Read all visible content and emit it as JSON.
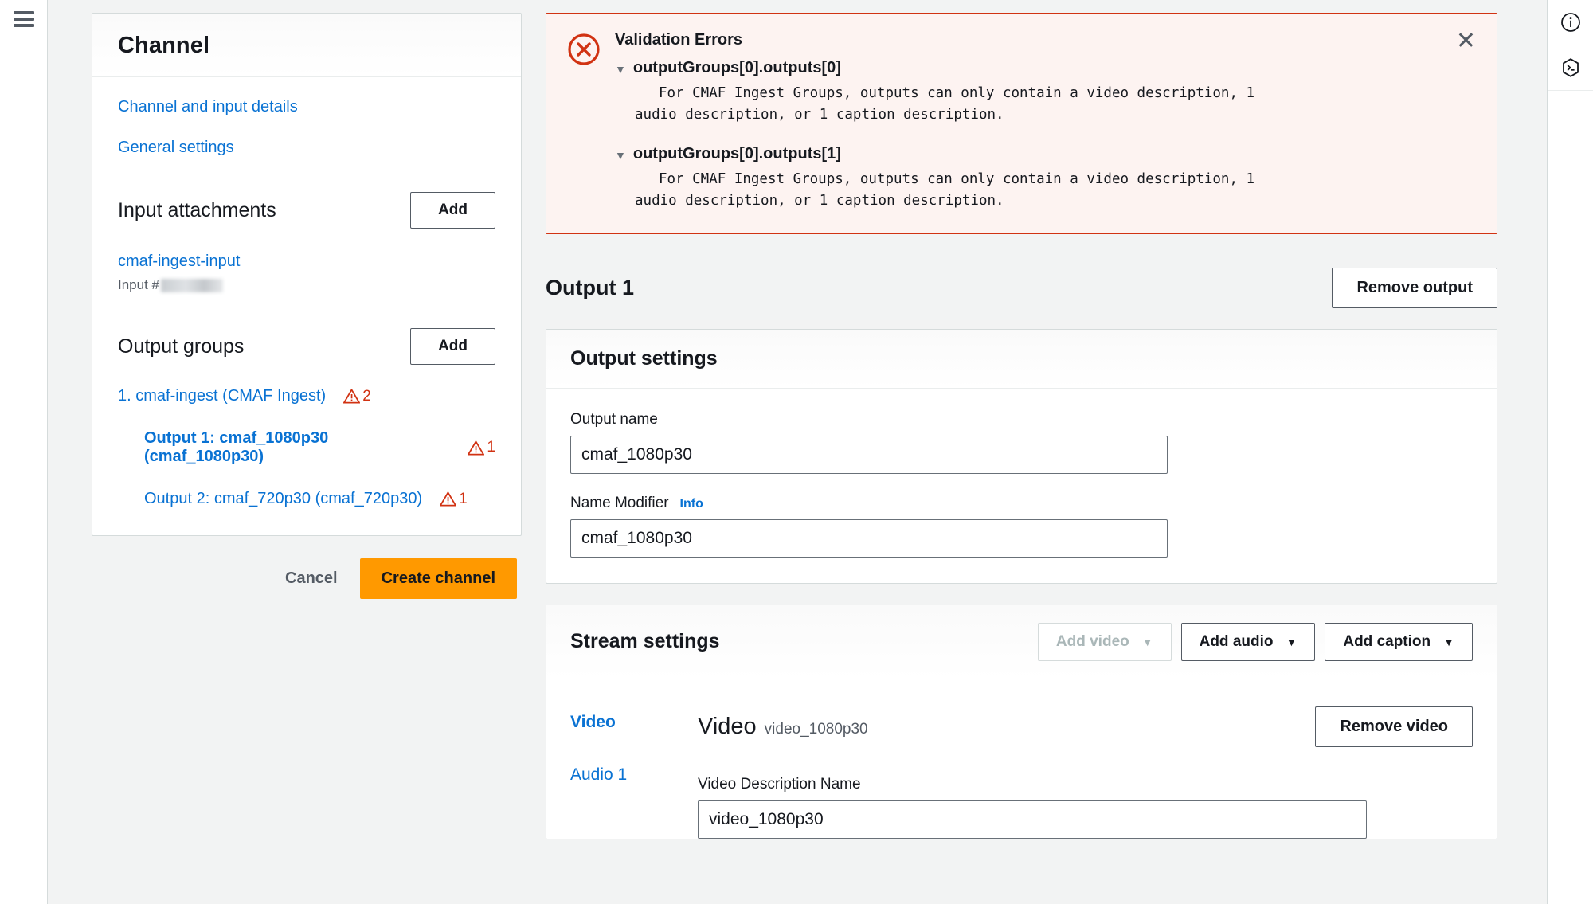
{
  "nav": {
    "menu_icon": "hamburger-icon"
  },
  "channel_card": {
    "title": "Channel",
    "links": [
      {
        "label": "Channel and input details"
      },
      {
        "label": "General settings"
      }
    ],
    "input_attachments": {
      "title": "Input attachments",
      "add_label": "Add",
      "items": [
        {
          "name": "cmaf-ingest-input",
          "sub_prefix": "Input #",
          "sub_value_redacted": true
        }
      ]
    },
    "output_groups": {
      "title": "Output groups",
      "add_label": "Add",
      "tree": [
        {
          "level": 1,
          "label": "1. cmaf-ingest (CMAF Ingest)",
          "warnings": "2",
          "selected": false
        },
        {
          "level": 2,
          "label": "Output 1: cmaf_1080p30 (cmaf_1080p30)",
          "warnings": "1",
          "selected": true
        },
        {
          "level": 2,
          "label": "Output 2: cmaf_720p30 (cmaf_720p30)",
          "warnings": "1",
          "selected": false
        }
      ]
    },
    "footer": {
      "cancel_label": "Cancel",
      "create_label": "Create channel"
    }
  },
  "alert": {
    "title": "Validation Errors",
    "icon": "error-circle-icon",
    "close_icon": "close-icon",
    "errors": [
      {
        "key": "outputGroups[0].outputs[0]",
        "message": "For CMAF Ingest Groups, outputs can only contain a video description, 1 audio description, or 1 caption description."
      },
      {
        "key": "outputGroups[0].outputs[1]",
        "message": "For CMAF Ingest Groups, outputs can only contain a video description, 1 audio description, or 1 caption description."
      }
    ]
  },
  "output": {
    "title": "Output 1",
    "remove_label": "Remove output",
    "settings_panel": {
      "heading": "Output settings",
      "fields": [
        {
          "label": "Output name",
          "value": "cmaf_1080p30",
          "info": null
        },
        {
          "label": "Name Modifier",
          "value": "cmaf_1080p30",
          "info": "Info"
        }
      ]
    },
    "stream_panel": {
      "heading": "Stream settings",
      "buttons": [
        {
          "label": "Add video",
          "caret": "▼",
          "disabled": true
        },
        {
          "label": "Add audio",
          "caret": "▼",
          "disabled": false
        },
        {
          "label": "Add caption",
          "caret": "▼",
          "disabled": false
        }
      ],
      "tabs": [
        {
          "label": "Video",
          "active": true
        },
        {
          "label": "Audio 1",
          "active": false
        }
      ],
      "stream_title": "Video",
      "stream_subtitle": "video_1080p30",
      "remove_label": "Remove video",
      "description_label": "Video Description Name",
      "description_value": "video_1080p30"
    }
  },
  "icon_rail": [
    {
      "name": "info-icon"
    },
    {
      "name": "cloudshell-icon"
    }
  ],
  "colors": {
    "link": "#0972d3",
    "error": "#d13212",
    "alert_bg": "#fdf3f1",
    "primary": "#ff9900",
    "page_bg": "#f2f3f3"
  }
}
